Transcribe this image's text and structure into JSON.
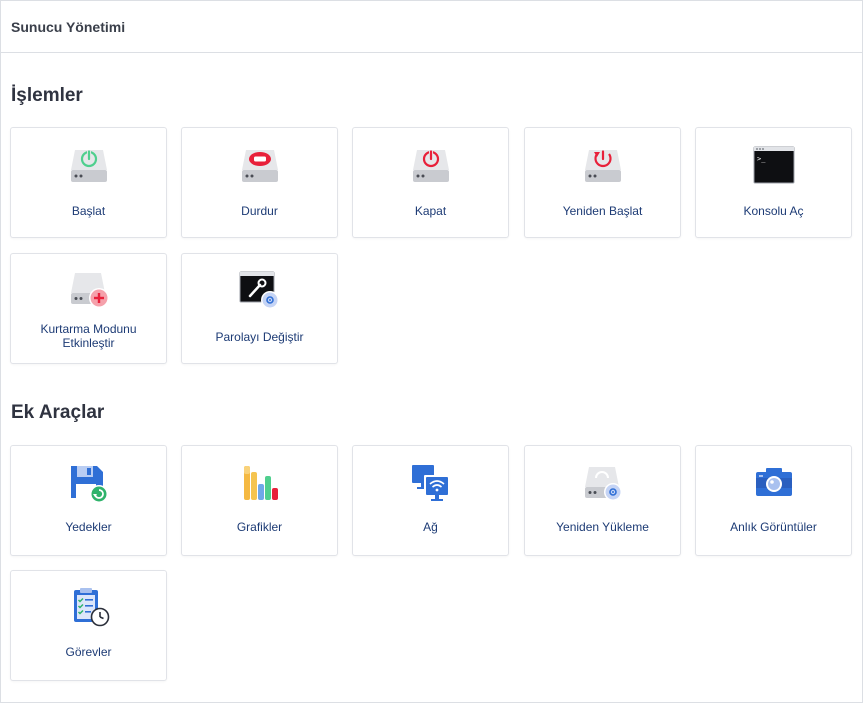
{
  "header": {
    "title": "Sunucu Yönetimi"
  },
  "sections": {
    "operations": {
      "title": "İşlemler",
      "items": [
        {
          "label": "Başlat",
          "icon": "power-on-server-icon"
        },
        {
          "label": "Durdur",
          "icon": "stop-server-icon"
        },
        {
          "label": "Kapat",
          "icon": "shutdown-server-icon"
        },
        {
          "label": "Yeniden Başlat",
          "icon": "restart-server-icon"
        },
        {
          "label": "Konsolu Aç",
          "icon": "console-icon"
        },
        {
          "label": "Kurtarma Modunu Etkinleştir",
          "icon": "rescue-mode-icon"
        },
        {
          "label": "Parolayı Değiştir",
          "icon": "change-password-icon"
        }
      ]
    },
    "tools": {
      "title": "Ek Araçlar",
      "items": [
        {
          "label": "Yedekler",
          "icon": "backup-icon"
        },
        {
          "label": "Grafikler",
          "icon": "graphs-icon"
        },
        {
          "label": "Ağ",
          "icon": "network-icon"
        },
        {
          "label": "Yeniden Yükleme",
          "icon": "reinstall-icon"
        },
        {
          "label": "Anlık Görüntüler",
          "icon": "snapshot-camera-icon"
        },
        {
          "label": "Görevler",
          "icon": "tasks-clipboard-icon"
        }
      ]
    }
  },
  "colors": {
    "green": "#4fcf8e",
    "red": "#e8203a",
    "blue": "#2f6fd6",
    "label": "#1d3b75"
  }
}
